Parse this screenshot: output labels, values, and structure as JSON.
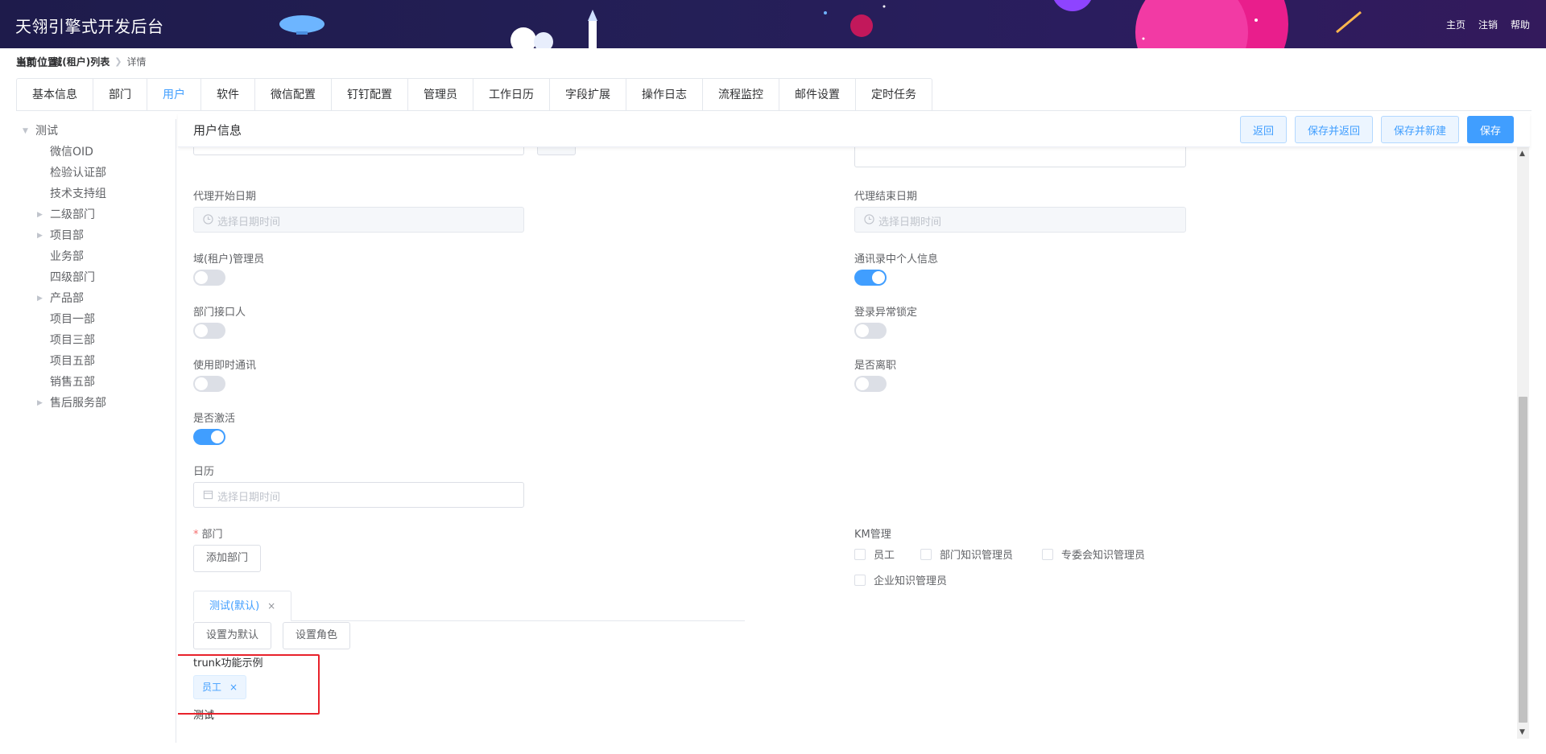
{
  "app": {
    "title": "天翎引擎式开发后台"
  },
  "header": {
    "links": [
      "主页",
      "注销",
      "帮助"
    ]
  },
  "breadcrumb": {
    "label": "当前位置:",
    "items": [
      "主页",
      "域(租户)列表"
    ],
    "current": "详情"
  },
  "tabs": [
    {
      "label": "基本信息"
    },
    {
      "label": "部门"
    },
    {
      "label": "用户",
      "active": true
    },
    {
      "label": "软件"
    },
    {
      "label": "微信配置"
    },
    {
      "label": "钉钉配置"
    },
    {
      "label": "管理员"
    },
    {
      "label": "工作日历"
    },
    {
      "label": "字段扩展"
    },
    {
      "label": "操作日志"
    },
    {
      "label": "流程监控"
    },
    {
      "label": "邮件设置"
    },
    {
      "label": "定时任务"
    }
  ],
  "tree": [
    {
      "label": "测试",
      "expanded": true
    },
    {
      "label": "微信OID"
    },
    {
      "label": "检验认证部"
    },
    {
      "label": "技术支持组"
    },
    {
      "label": "二级部门",
      "collapsed": true
    },
    {
      "label": "项目部",
      "collapsed": true
    },
    {
      "label": "业务部"
    },
    {
      "label": "四级部门"
    },
    {
      "label": "产品部",
      "collapsed": true
    },
    {
      "label": "项目一部"
    },
    {
      "label": "项目三部"
    },
    {
      "label": "项目五部"
    },
    {
      "label": "销售五部"
    },
    {
      "label": "售后服务部",
      "collapsed": true
    }
  ],
  "panel": {
    "title": "用户信息",
    "buttons": {
      "back": "返回",
      "save_back": "保存并返回",
      "save_new": "保存并新建",
      "save": "保存"
    }
  },
  "form": {
    "proxy_start": {
      "label": "代理开始日期",
      "placeholder": "选择日期时间"
    },
    "proxy_end": {
      "label": "代理结束日期",
      "placeholder": "选择日期时间"
    },
    "domain_admin": {
      "label": "域(租户)管理员",
      "on": false
    },
    "contact_personal": {
      "label": "通讯录中个人信息",
      "on": true
    },
    "dept_contact": {
      "label": "部门接口人",
      "on": false
    },
    "login_lock": {
      "label": "登录异常锁定",
      "on": false
    },
    "instant_msg": {
      "label": "使用即时通讯",
      "on": false
    },
    "resigned": {
      "label": "是否离职",
      "on": false
    },
    "activated": {
      "label": "是否激活",
      "on": true
    },
    "calendar": {
      "label": "日历",
      "placeholder": "选择日期时间"
    },
    "department": {
      "required_mark": "*",
      "label": "部门",
      "add_button": "添加部门",
      "tab": "测试(默认)",
      "close": "×",
      "set_default": "设置为默认",
      "set_role": "设置角色"
    },
    "km": {
      "label": "KM管理",
      "options": [
        "员工",
        "部门知识管理员",
        "专委会知识管理员",
        "企业知识管理员"
      ]
    },
    "trunk": {
      "label": "trunk功能示例",
      "tag": "员工",
      "close": "×",
      "note": "测试"
    }
  },
  "colors": {
    "primary": "#409eff",
    "header_bg": "#1e1b4b",
    "highlight_box": "#e8222b"
  }
}
